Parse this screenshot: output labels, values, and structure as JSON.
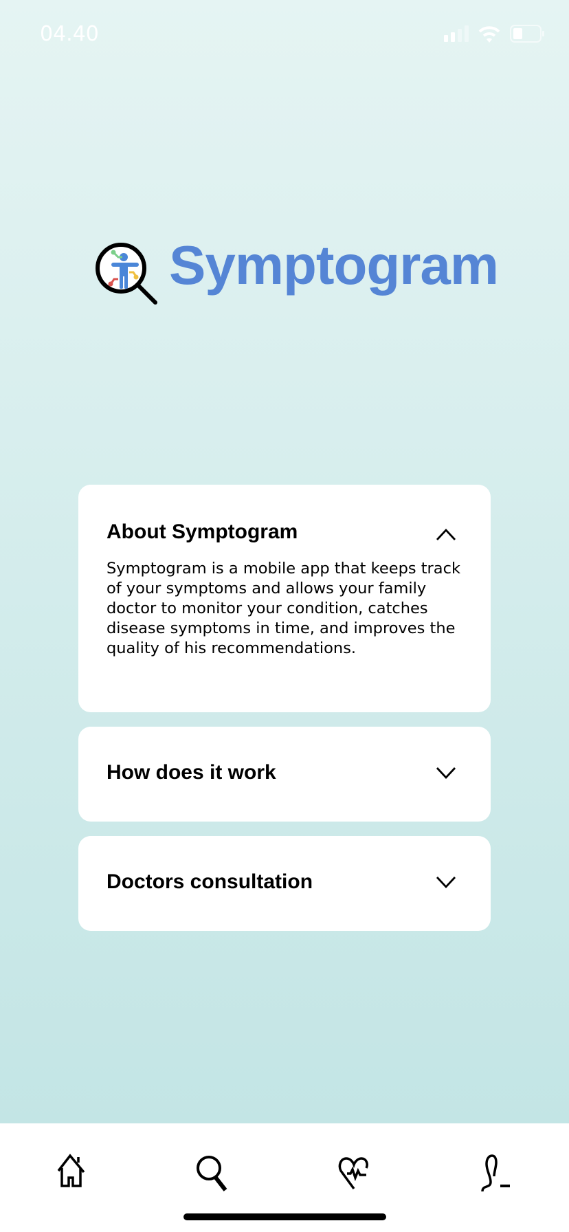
{
  "status_bar": {
    "time": "04.40"
  },
  "brand": {
    "name": "Symptogram",
    "color": "#5585d5"
  },
  "accordion": [
    {
      "title": "About Symptogram",
      "expanded": true,
      "body": "Symptogram is a mobile app that keeps track of your symptoms and allows your family doctor to monitor your condition, catches disease symptoms in time, and improves the quality of his recommendations."
    },
    {
      "title": "How does it work",
      "expanded": false
    },
    {
      "title": "Doctors consultation",
      "expanded": false
    }
  ],
  "nav": [
    {
      "icon": "home-icon"
    },
    {
      "icon": "search-icon",
      "active": true
    },
    {
      "icon": "heart-pulse-icon"
    },
    {
      "icon": "profile-icon"
    }
  ]
}
